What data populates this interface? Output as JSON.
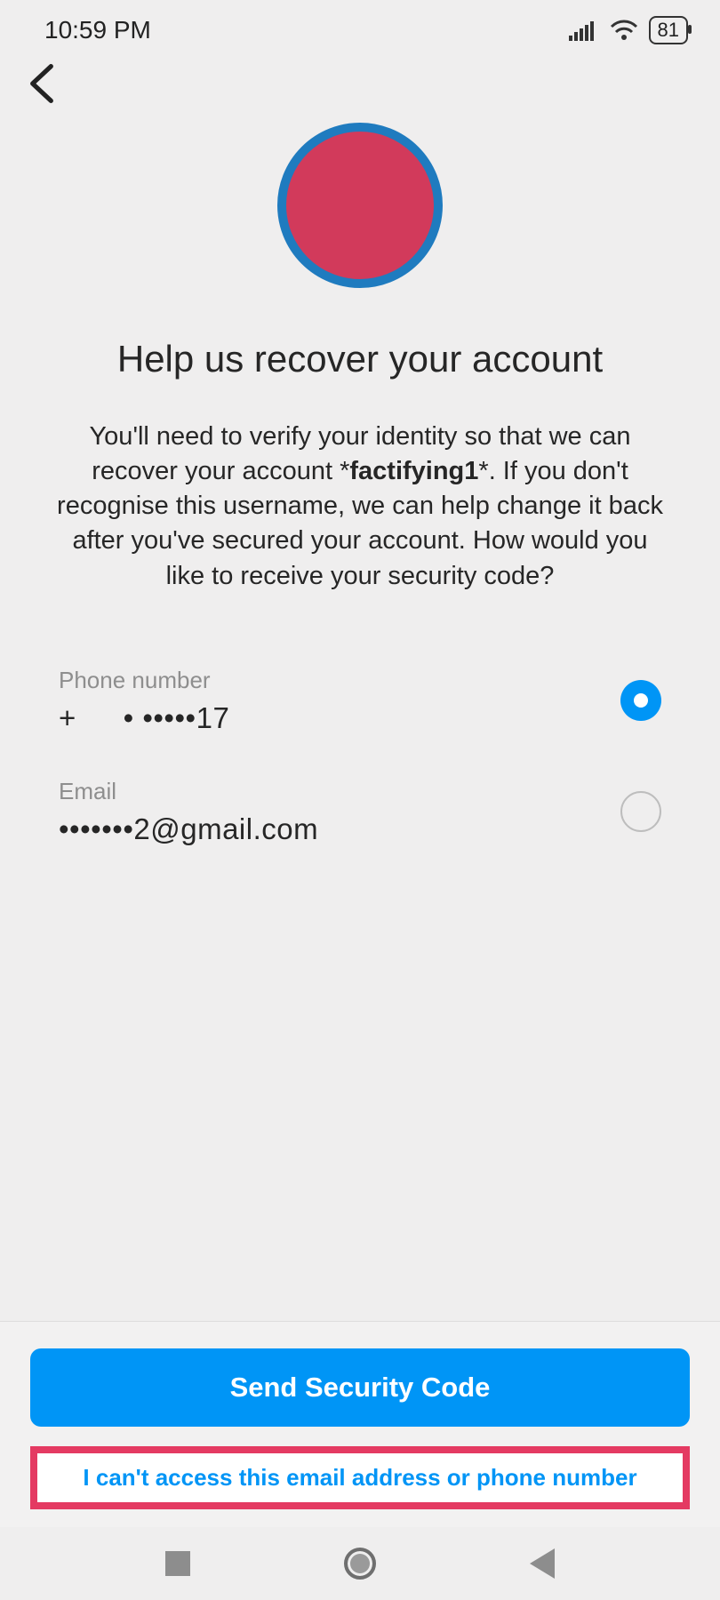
{
  "status": {
    "time": "10:59 PM",
    "battery": "81"
  },
  "page": {
    "title": "Help us recover your account",
    "desc_prefix": "You'll need to verify your identity so that we can recover your account *",
    "username": "factifying1",
    "desc_suffix": "*. If you don't recognise this username, we can help change it back after you've secured your account. How would you like to receive your security code?"
  },
  "options": {
    "phone": {
      "label": "Phone number",
      "value": "+   • •••••17",
      "selected": true
    },
    "email": {
      "label": "Email",
      "value": "•••••••2@gmail.com",
      "selected": false
    }
  },
  "actions": {
    "primary": "Send Security Code",
    "cant_access": "I can't access this email address or phone number"
  }
}
